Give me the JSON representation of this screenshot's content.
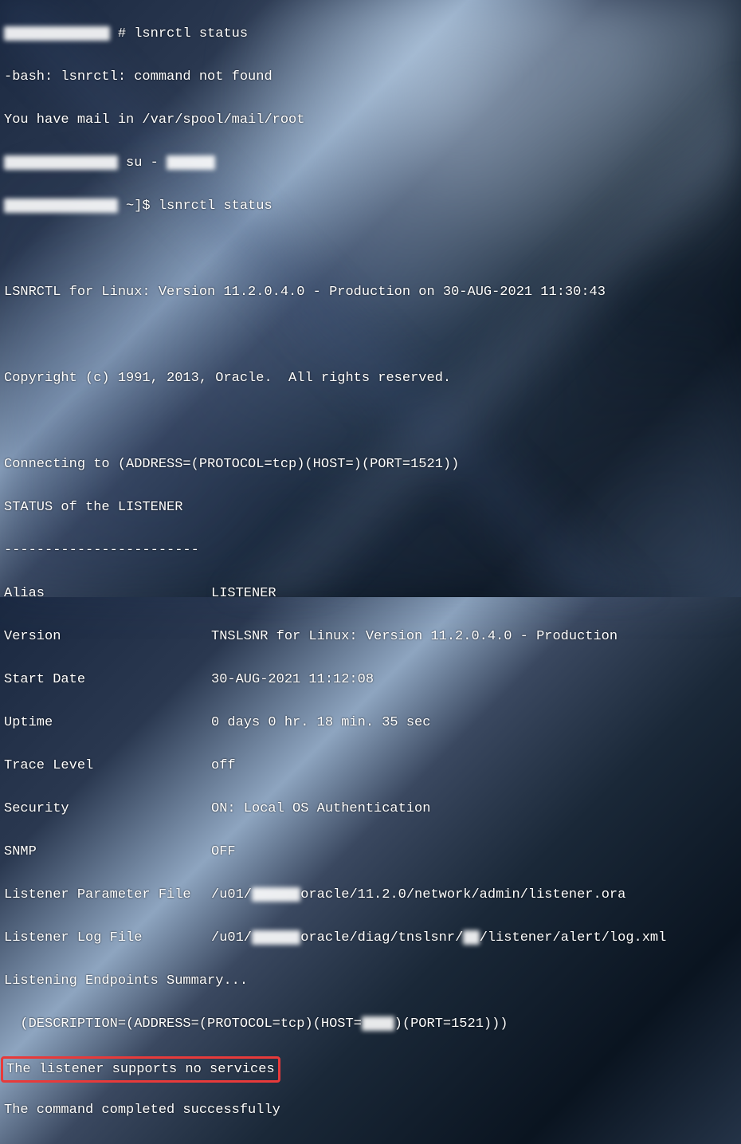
{
  "prompt1": {
    "redacted_prefix": "             ",
    "cmd": " # lsnrctl status"
  },
  "err": "-bash: lsnrctl: command not found",
  "mail": "You have mail in /var/spool/mail/root",
  "prompt2": {
    "redacted_prefix": "              ",
    "cmd": " su - ",
    "redacted_suffix": "      "
  },
  "prompt3": {
    "redacted_prefix": "              ",
    "cmd": " ~]$ lsnrctl status"
  },
  "banner": "LSNRCTL for Linux: Version 11.2.0.4.0 - Production on 30-AUG-2021 11:30:43",
  "copyright": "Copyright (c) 1991, 2013, Oracle.  All rights reserved.",
  "connecting": "Connecting to (ADDRESS=(PROTOCOL=tcp)(HOST=)(PORT=1521))",
  "status_header": "STATUS of the LISTENER",
  "dashes": "------------------------",
  "kv": {
    "alias": {
      "label": "Alias",
      "value": "LISTENER"
    },
    "version": {
      "label": "Version",
      "value": "TNSLSNR for Linux: Version 11.2.0.4.0 - Production"
    },
    "start_date": {
      "label": "Start Date",
      "value": "30-AUG-2021 11:12:08"
    },
    "uptime": {
      "label": "Uptime",
      "value": "0 days 0 hr. 18 min. 35 sec"
    },
    "trace": {
      "label": "Trace Level",
      "value": "off"
    },
    "security": {
      "label": "Security",
      "value": "ON: Local OS Authentication"
    },
    "snmp": {
      "label": "SNMP",
      "value": "OFF"
    },
    "param_file": {
      "label": "Listener Parameter File",
      "prefix": "/u01/",
      "redacted": "      ",
      "suffix": "oracle/11.2.0/network/admin/listener.ora"
    },
    "log_file": {
      "label": "Listener Log File",
      "prefix": "/u01/",
      "redacted": "      ",
      "mid": "oracle/diag/tnslsnr/",
      "redacted2": "  ",
      "suffix": "/listener/alert/log.xml"
    }
  },
  "endpoints_header": "Listening Endpoints Summary...",
  "endpoint_line": {
    "prefix": "  (DESCRIPTION=(ADDRESS=(PROTOCOL=tcp)(HOST=",
    "redacted": "    ",
    "suffix": ")(PORT=1521)))"
  },
  "no_services": "The listener supports no services",
  "completed": "The command completed successfully"
}
